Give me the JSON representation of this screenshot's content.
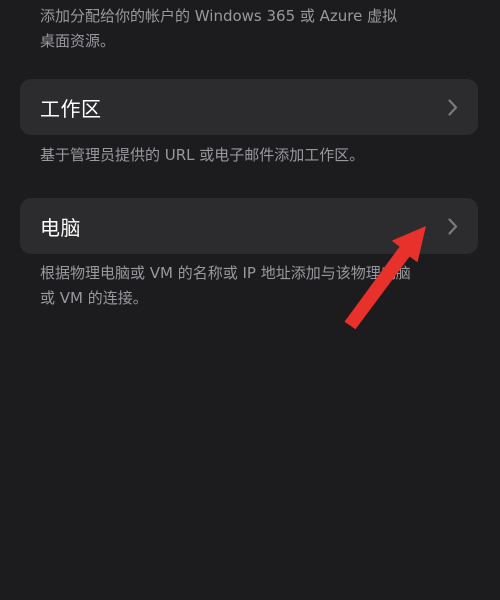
{
  "top_description": "添加分配给你的帐户的 Windows 365 或 Azure 虚拟\n桌面资源。",
  "items": [
    {
      "label": "工作区",
      "description": "基于管理员提供的 URL 或电子邮件添加工作区。"
    },
    {
      "label": "电脑",
      "description": "根据物理电脑或 VM 的名称或 IP 地址添加与该物理电脑\n或 VM 的连接。"
    }
  ],
  "icons": {
    "row_chevron": "chevron-right-icon",
    "annotation": "red-arrow-annotation"
  },
  "colors": {
    "background": "#1c1c1e",
    "card": "#2c2c2e",
    "secondary_text": "#98989f",
    "annotation_arrow": "#e8312a"
  }
}
